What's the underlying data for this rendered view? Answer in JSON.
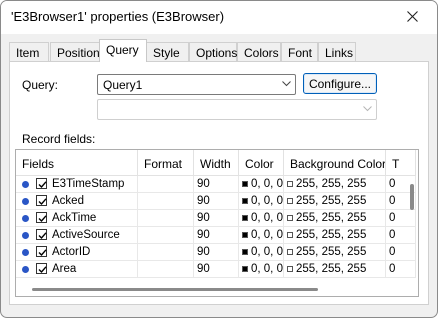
{
  "window": {
    "title": "'E3Browser1' properties (E3Browser)"
  },
  "tabs": [
    {
      "label": "Item"
    },
    {
      "label": "Position"
    },
    {
      "label": "Query"
    },
    {
      "label": "Style"
    },
    {
      "label": "Options"
    },
    {
      "label": "Colors"
    },
    {
      "label": "Font"
    },
    {
      "label": "Links"
    }
  ],
  "active_tab": "Query",
  "query": {
    "label": "Query:",
    "selected": "Query1",
    "configure_label": "Configure...",
    "secondary_value": ""
  },
  "record_fields": {
    "label": "Record fields:",
    "columns": [
      "Fields",
      "Format",
      "Width",
      "Color",
      "Background Color",
      "T"
    ],
    "rows": [
      {
        "field": "E3TimeStamp",
        "checked": true,
        "format": "",
        "width": "90",
        "color": "0, 0, 0",
        "bgcolor": "255, 255, 255",
        "t": "0"
      },
      {
        "field": "Acked",
        "checked": true,
        "format": "",
        "width": "90",
        "color": "0, 0, 0",
        "bgcolor": "255, 255, 255",
        "t": "0"
      },
      {
        "field": "AckTime",
        "checked": true,
        "format": "",
        "width": "90",
        "color": "0, 0, 0",
        "bgcolor": "255, 255, 255",
        "t": "0"
      },
      {
        "field": "ActiveSource",
        "checked": true,
        "format": "",
        "width": "90",
        "color": "0, 0, 0",
        "bgcolor": "255, 255, 255",
        "t": "0"
      },
      {
        "field": "ActorID",
        "checked": true,
        "format": "",
        "width": "90",
        "color": "0, 0, 0",
        "bgcolor": "255, 255, 255",
        "t": "0"
      },
      {
        "field": "Area",
        "checked": true,
        "format": "",
        "width": "90",
        "color": "0, 0, 0",
        "bgcolor": "255, 255, 255",
        "t": "0"
      }
    ]
  },
  "icons": {
    "close": "close-icon",
    "dropdown": "chevron-down-icon",
    "row_marker": "field-dot-icon",
    "checkbox": "checkbox-checked-icon"
  },
  "colors": {
    "accent": "#005fb8",
    "row_marker": "#2a56c6",
    "swatch_color": "#000000",
    "swatch_bg": "#ffffff"
  }
}
